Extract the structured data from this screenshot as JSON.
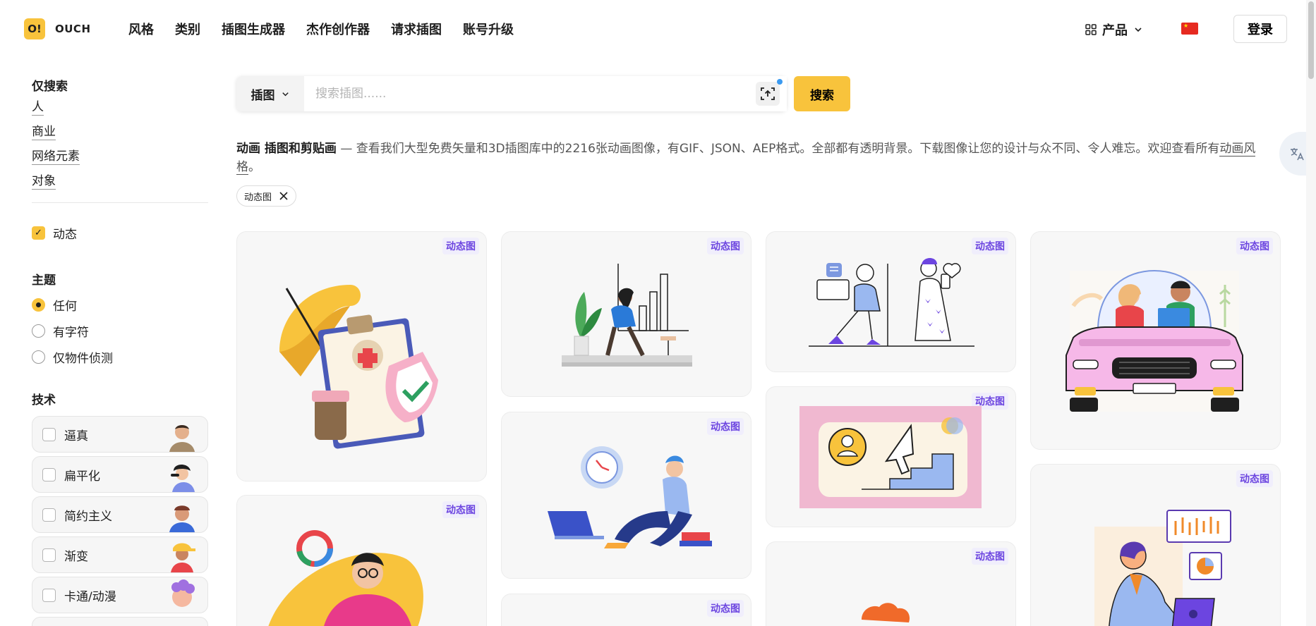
{
  "brand": {
    "logo_mark": "O!",
    "name": "OUCH"
  },
  "nav": [
    "风格",
    "类别",
    "插图生成器",
    "杰作创作器",
    "请求插图",
    "账号升级"
  ],
  "header": {
    "product_label": "产品",
    "login_label": "登录"
  },
  "sidebar": {
    "search_only_title": "仅搜索",
    "search_only_links": [
      "人",
      "商业",
      "网络元素",
      "对象"
    ],
    "animated_label": "动态",
    "theme_title": "主题",
    "theme_options": [
      "任何",
      "有字符",
      "仅物件侦测"
    ],
    "tech_title": "技术",
    "tech_items": [
      "逼真",
      "扁平化",
      "简约主义",
      "渐变",
      "卡通/动漫"
    ]
  },
  "search": {
    "type_label": "插图",
    "placeholder": "搜索插图......",
    "button_label": "搜索"
  },
  "description": {
    "bold": "动画 插图和剪贴画",
    "text": " — 查看我们大型免费矢量和3D插图库中的2216张动画图像，有GIF、JSON、AEP格式。全部都有透明背景。下载图像让您的设计与众不同、令人难忘。欢迎查看所有",
    "link": "动画风格",
    "end": "。"
  },
  "filter_chip": "动态图",
  "card_badge": "动态图",
  "colors": {
    "accent": "#f8c33c",
    "badge_text": "#6c45e0",
    "badge_bg": "#f0eefc"
  },
  "icons": [
    "grid-icon",
    "chevron-down-icon",
    "flag-icon",
    "image-search-icon",
    "close-icon",
    "translate-icon",
    "check-icon"
  ]
}
